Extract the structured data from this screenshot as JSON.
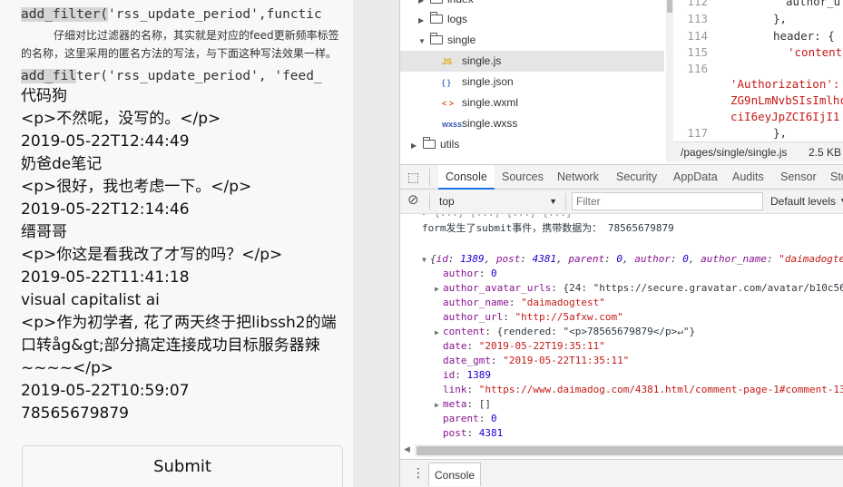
{
  "simulator": {
    "code_line_1": {
      "highlight": "add_filter(",
      "rest": "'rss_update_period',functic"
    },
    "paragraph": "仔细对比过滤器的名称，其实就是对应的feed更新频率标签的名称，这里采用的匿名方法的写法，与下面这种写法效果一样。",
    "code_line_2": {
      "highlight": "add_fil",
      "rest": "ter('rss_update_period', 'feed_"
    },
    "entries": [
      "代码狗",
      "<p>不然呢，没写的。</p>",
      "2019-05-22T12:44:49",
      "奶爸de笔记",
      "<p>很好，我也考虑一下。</p>",
      "2019-05-22T12:14:46",
      "缙哥哥",
      "<p>你这是看我改了才写的吗？</p>",
      "2019-05-22T11:41:18",
      "visual capitalist ai",
      "<p>作为初学者, 花了两天终于把libssh2的端口转åg&gt;部分搞定连接成功目标服务器辣~~~~</p>",
      "2019-05-22T10:59:07",
      "78565679879"
    ],
    "submit_label": "Submit"
  },
  "devtools": {
    "tree": {
      "items": [
        {
          "name": "index",
          "kind": "folder",
          "expanded": false
        },
        {
          "name": "logs",
          "kind": "folder",
          "expanded": false
        },
        {
          "name": "single",
          "kind": "folder",
          "expanded": true
        },
        {
          "name": "single.js",
          "kind": "js",
          "icon": "JS",
          "selected": true
        },
        {
          "name": "single.json",
          "kind": "json",
          "icon": "{ }"
        },
        {
          "name": "single.wxml",
          "kind": "wxml",
          "icon": "< >"
        },
        {
          "name": "single.wxss",
          "kind": "wxss",
          "icon": "wxss"
        },
        {
          "name": "utils",
          "kind": "folder",
          "expanded": false
        }
      ]
    },
    "editor": {
      "line_numbers": [
        "112",
        "113",
        "114",
        "115",
        "116",
        "117"
      ],
      "lines": [
        "author_u",
        "},",
        "header: {",
        "'content",
        "'Authorization':",
        "ZG9nLmNvbSIsImlhc",
        "ciI6eyJpZCI6IjI1",
        "},"
      ],
      "status_path": "/pages/single/single.js",
      "status_size": "2.5 KB"
    },
    "tabs": [
      "Console",
      "Sources",
      "Network",
      "Security",
      "AppData",
      "Audits",
      "Sensor",
      "Sto"
    ],
    "active_tab": "Console",
    "filter": {
      "context": "top",
      "placeholder": "Filter",
      "levels": "Default levels ▼"
    },
    "console": {
      "truncated_top": "▸ {...} [...] {...} {...}",
      "submit_msg": "form发生了submit事件，携带数据为： 78565679879",
      "object_summary": {
        "open": "{",
        "id_key": "id",
        "id_val": "1389",
        "post_key": "post",
        "post_val": "4381",
        "parent_key": "parent",
        "parent_val": "0",
        "author_key": "author",
        "author_val": "0",
        "author_name_key": "author_name",
        "author_name_val": "\"daimadogte"
      },
      "props": [
        {
          "key": "author",
          "value": "0",
          "type": "num",
          "expandable": false
        },
        {
          "key": "author_avatar_urls",
          "value": "{24: \"https://secure.gravatar.com/avatar/b10c56",
          "type": "obj",
          "expandable": true
        },
        {
          "key": "author_name",
          "value": "\"daimadogtest\"",
          "type": "str",
          "expandable": false
        },
        {
          "key": "author_url",
          "value": "\"http://5afxw.com\"",
          "type": "str",
          "expandable": false
        },
        {
          "key": "content",
          "value": "{rendered: \"<p>78565679879</p>↵\"}",
          "type": "obj",
          "expandable": true
        },
        {
          "key": "date",
          "value": "\"2019-05-22T19:35:11\"",
          "type": "str",
          "expandable": false
        },
        {
          "key": "date_gmt",
          "value": "\"2019-05-22T11:35:11\"",
          "type": "str",
          "expandable": false
        },
        {
          "key": "id",
          "value": "1389",
          "type": "num",
          "expandable": false
        },
        {
          "key": "link",
          "value": "\"https://www.daimadog.com/4381.html/comment-page-1#comment-13",
          "type": "str",
          "expandable": false
        },
        {
          "key": "meta",
          "value": "[]",
          "type": "obj",
          "expandable": true
        },
        {
          "key": "parent",
          "value": "0",
          "type": "num",
          "expandable": false
        },
        {
          "key": "post",
          "value": "4381",
          "type": "num",
          "expandable": false
        }
      ]
    },
    "drawer_tab": "Console"
  }
}
